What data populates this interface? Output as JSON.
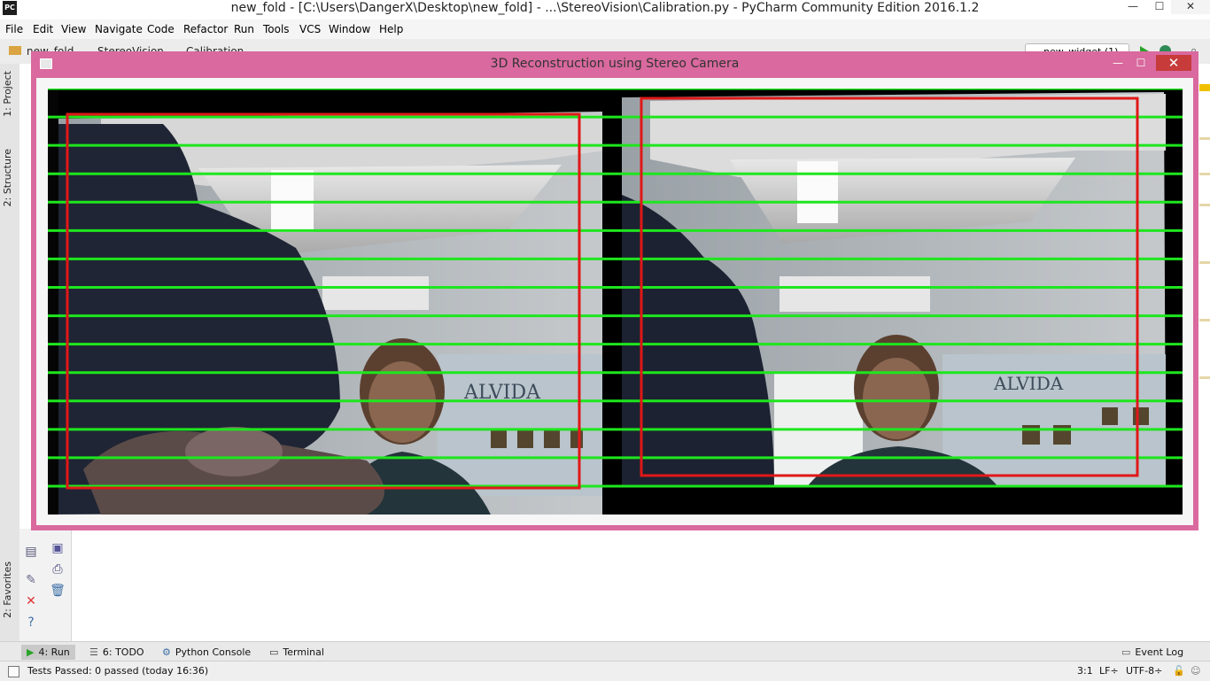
{
  "ide": {
    "window_title": "new_fold - [C:\\Users\\DangerX\\Desktop\\new_fold] - ...\\StereoVision\\Calibration.py - PyCharm Community Edition 2016.1.2",
    "app_icon_label": "PC",
    "window_controls": {
      "minimize": "—",
      "maximize": "☐",
      "close": "✕"
    },
    "menu": [
      "File",
      "Edit",
      "View",
      "Navigate",
      "Code",
      "Refactor",
      "Run",
      "Tools",
      "VCS",
      "Window",
      "Help"
    ],
    "breadcrumbs": [
      "new_fold",
      "StereoVision",
      "Calibration"
    ],
    "run_config": "new_widget (1)",
    "left_tabs": {
      "project": "1: Project",
      "structure": "2: Structure",
      "favorites": "2: Favorites"
    },
    "bottom_tabs": [
      {
        "label": "4: Run",
        "icon": "run-icon"
      },
      {
        "label": "6: TODO",
        "icon": "todo-icon"
      },
      {
        "label": "Python Console",
        "icon": "python-console-icon"
      },
      {
        "label": "Terminal",
        "icon": "terminal-icon"
      }
    ],
    "event_log": "Event Log",
    "status": {
      "message": "Tests Passed: 0 passed (today 16:36)",
      "position": "3:1",
      "line_separator": "LF÷",
      "encoding": "UTF-8÷"
    }
  },
  "cv_window": {
    "title": "3D Reconstruction using Stereo Camera",
    "controls": {
      "minimize": "—",
      "maximize": "☐",
      "close": "✕"
    },
    "overlay": {
      "epipolar_line_count": 15,
      "line_color": "#1ee61e",
      "roi_color": "#e01818",
      "left_roi": "red rectangle on left rectified image",
      "right_roi": "red rectangle on right rectified image",
      "scene_text": "ALVIDA"
    }
  },
  "colors": {
    "cv_frame": "#d9699e",
    "accent_run": "#29a329"
  }
}
